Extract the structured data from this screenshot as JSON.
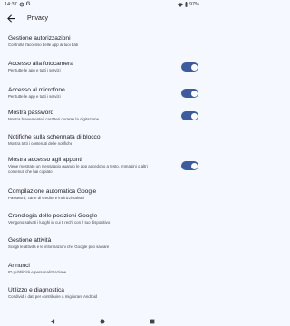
{
  "status_bar": {
    "time": "14:37",
    "battery": "97%",
    "icons": [
      "settings-gear-icon",
      "google-g-icon",
      "wifi-icon",
      "battery-icon"
    ]
  },
  "app_bar": {
    "title": "Privacy",
    "back_icon": "arrow-back-icon"
  },
  "accent_color": "#3e5b9e",
  "items": [
    {
      "title": "Gestione autorizzazioni",
      "subtitle": "Controlla l'accesso delle app ai tuoi dati"
    },
    {
      "title": "Accesso alla fotocamera",
      "subtitle": "Per tutte le app e tutti i servizi",
      "toggle": true
    },
    {
      "title": "Accesso al microfono",
      "subtitle": "Per tutte le app e tutti i servizi",
      "toggle": true
    },
    {
      "title": "Mostra password",
      "subtitle": "Mostra brevemente i caratteri durante la digitazione",
      "toggle": true
    },
    {
      "title": "Notifiche sulla schermata di blocco",
      "subtitle": "Mostra tutti i contenuti delle notifiche"
    },
    {
      "title": "Mostra accesso agli appunti",
      "subtitle_lines": [
        "Viene mostrato un messaggio quando le app accedono a testo, immagini o altri",
        "contenuti che hai copiato"
      ],
      "toggle": true
    },
    {
      "title": "Compilazione automatica Google",
      "subtitle": "Password, carte di credito e indirizzi salvati"
    },
    {
      "title": "Cronologia delle posizioni Google",
      "subtitle": "Vengono salvati i luoghi in cui ti rechi con il tuo dispositivo"
    },
    {
      "title": "Gestione attività",
      "subtitle": "Scegli le attività e le informazioni che Google può salvare"
    },
    {
      "title": "Annunci",
      "subtitle": "ID pubblicità e personalizzazione"
    },
    {
      "title": "Utilizzo e diagnostica",
      "subtitle": "Condividi i dati per contribuire a migliorare Android"
    }
  ],
  "nav_bar": {
    "icons": [
      "nav-back-icon",
      "nav-home-icon",
      "nav-recents-icon"
    ]
  }
}
